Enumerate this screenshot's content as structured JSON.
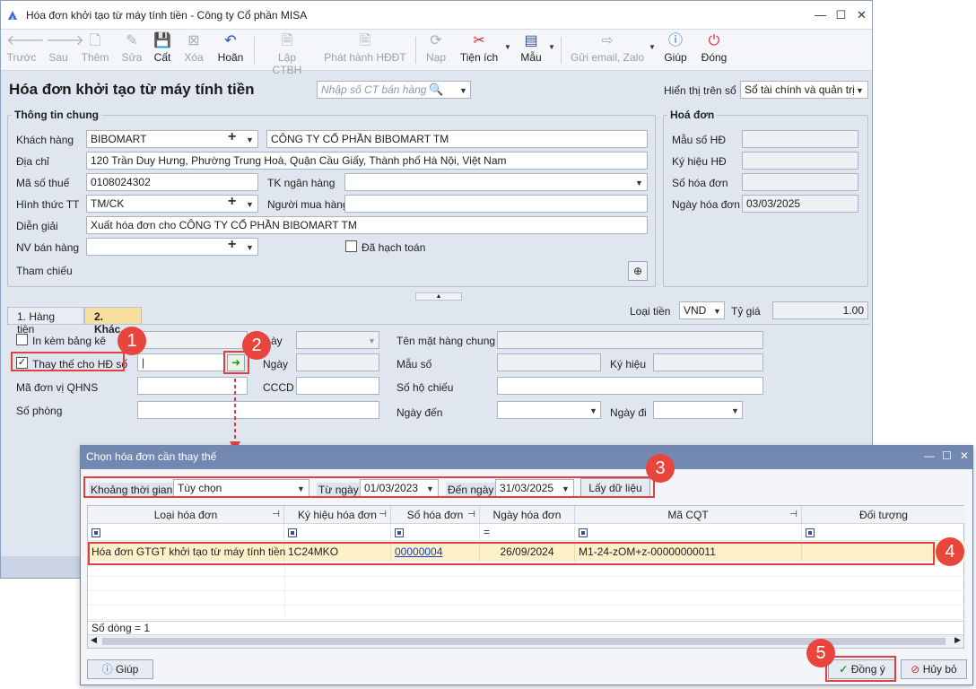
{
  "window": {
    "title": "Hóa đơn khởi tạo từ máy tính tiền - Công ty Cổ phần MISA",
    "controls": [
      "—",
      "☐",
      "✕"
    ]
  },
  "toolbar": {
    "prev": "Trước",
    "next": "Sau",
    "add": "Thêm",
    "edit": "Sửa",
    "save": "Cất",
    "delete": "Xóa",
    "undo": "Hoãn",
    "create_ctbh": "Lập CTBH",
    "issue_hddt": "Phát hành HĐĐT",
    "reload": "Nạp",
    "utilities": "Tiện ích",
    "template": "Mẫu",
    "send_email": "Gửi email, Zalo",
    "help": "Giúp",
    "close": "Đóng"
  },
  "header": {
    "page_title": "Hóa đơn khởi tạo từ máy tính tiền",
    "search_placeholder": "Nhập số CT bán hàng",
    "display_label": "Hiển thị trên sổ",
    "display_value": "Sổ tài chính và quản trị"
  },
  "general": {
    "title": "Thông tin chung",
    "customer_label": "Khách hàng",
    "customer_code": "BIBOMART",
    "customer_name": "CÔNG TY CỔ PHẦN BIBOMART TM",
    "address_label": "Địa chỉ",
    "address": "120 Trần Duy Hưng, Phường Trung Hoà, Quận Cầu Giấy, Thành phố Hà Nội, Việt Nam",
    "tax_label": "Mã số thuế",
    "tax_code": "0108024302",
    "bank_label": "TK ngân hàng",
    "payment_label": "Hình thức TT",
    "payment": "TM/CK",
    "buyer_label": "Người mua hàng",
    "desc_label": "Diễn giải",
    "desc": "Xuất hóa đơn cho CÔNG TY CỔ PHẦN BIBOMART TM",
    "sales_label": "NV bán hàng",
    "posted_label": "Đã hạch toán",
    "ref_label": "Tham chiếu"
  },
  "invoice": {
    "title": "Hoá đơn",
    "template_label": "Mẫu số HĐ",
    "symbol_label": "Ký hiệu HĐ",
    "number_label": "Số hóa đơn",
    "date_label": "Ngày hóa đơn",
    "date": "03/03/2025"
  },
  "tabs": [
    {
      "label": "1. Hàng tiền"
    },
    {
      "label": "2. Khác"
    }
  ],
  "currency": {
    "label": "Loại tiền",
    "value": "VND",
    "rate_label": "Tỷ giá",
    "rate": "1.00"
  },
  "other": {
    "attach_label": "In kèm bảng kê",
    "replace_label": "Thay thế cho HĐ số",
    "date_partial": "ày",
    "date_label": "Ngày",
    "qhns_label": "Mã đơn vị QHNS",
    "cccd_label": "CCCD",
    "room_label": "Số phòng",
    "general_item_label": "Tên mặt hàng chung",
    "template_label": "Mẫu số",
    "symbol_label": "Ký hiệu",
    "passport_label": "Số hộ chiếu",
    "arrive_label": "Ngày đến",
    "leave_label": "Ngày đi"
  },
  "steps": [
    "1",
    "2",
    "3",
    "4",
    "5"
  ],
  "dialog": {
    "title": "Chọn hóa đơn cần thay thế",
    "period_label": "Khoảng thời gian",
    "period_value": "Tùy chọn",
    "from_label": "Từ ngày",
    "from": "01/03/2023",
    "to_label": "Đến ngày",
    "to": "31/03/2025",
    "fetch_button": "Lấy dữ liệu",
    "columns": [
      "Loại hóa đơn",
      "Ký hiệu hóa đơn",
      "Số hóa đơn",
      "Ngày hóa đơn",
      "Mã CQT",
      "Đối tượng"
    ],
    "date_filter_op": "=",
    "row": {
      "type": "Hóa đơn GTGT khởi tạo từ máy tính tiền",
      "symbol": "1C24MKO",
      "number": "00000004",
      "date": "26/09/2024",
      "cqt": "M1-24-zOM+z-00000000011",
      "object": ""
    },
    "row_count": "Số dòng = 1",
    "help_button": "Giúp",
    "ok_button": "Đồng ý",
    "cancel_button": "Hủy bỏ"
  },
  "colors": {
    "accent_red": "#e8453c",
    "dialog_title": "#7388b0",
    "row_highlight": "#fbf0c8"
  }
}
